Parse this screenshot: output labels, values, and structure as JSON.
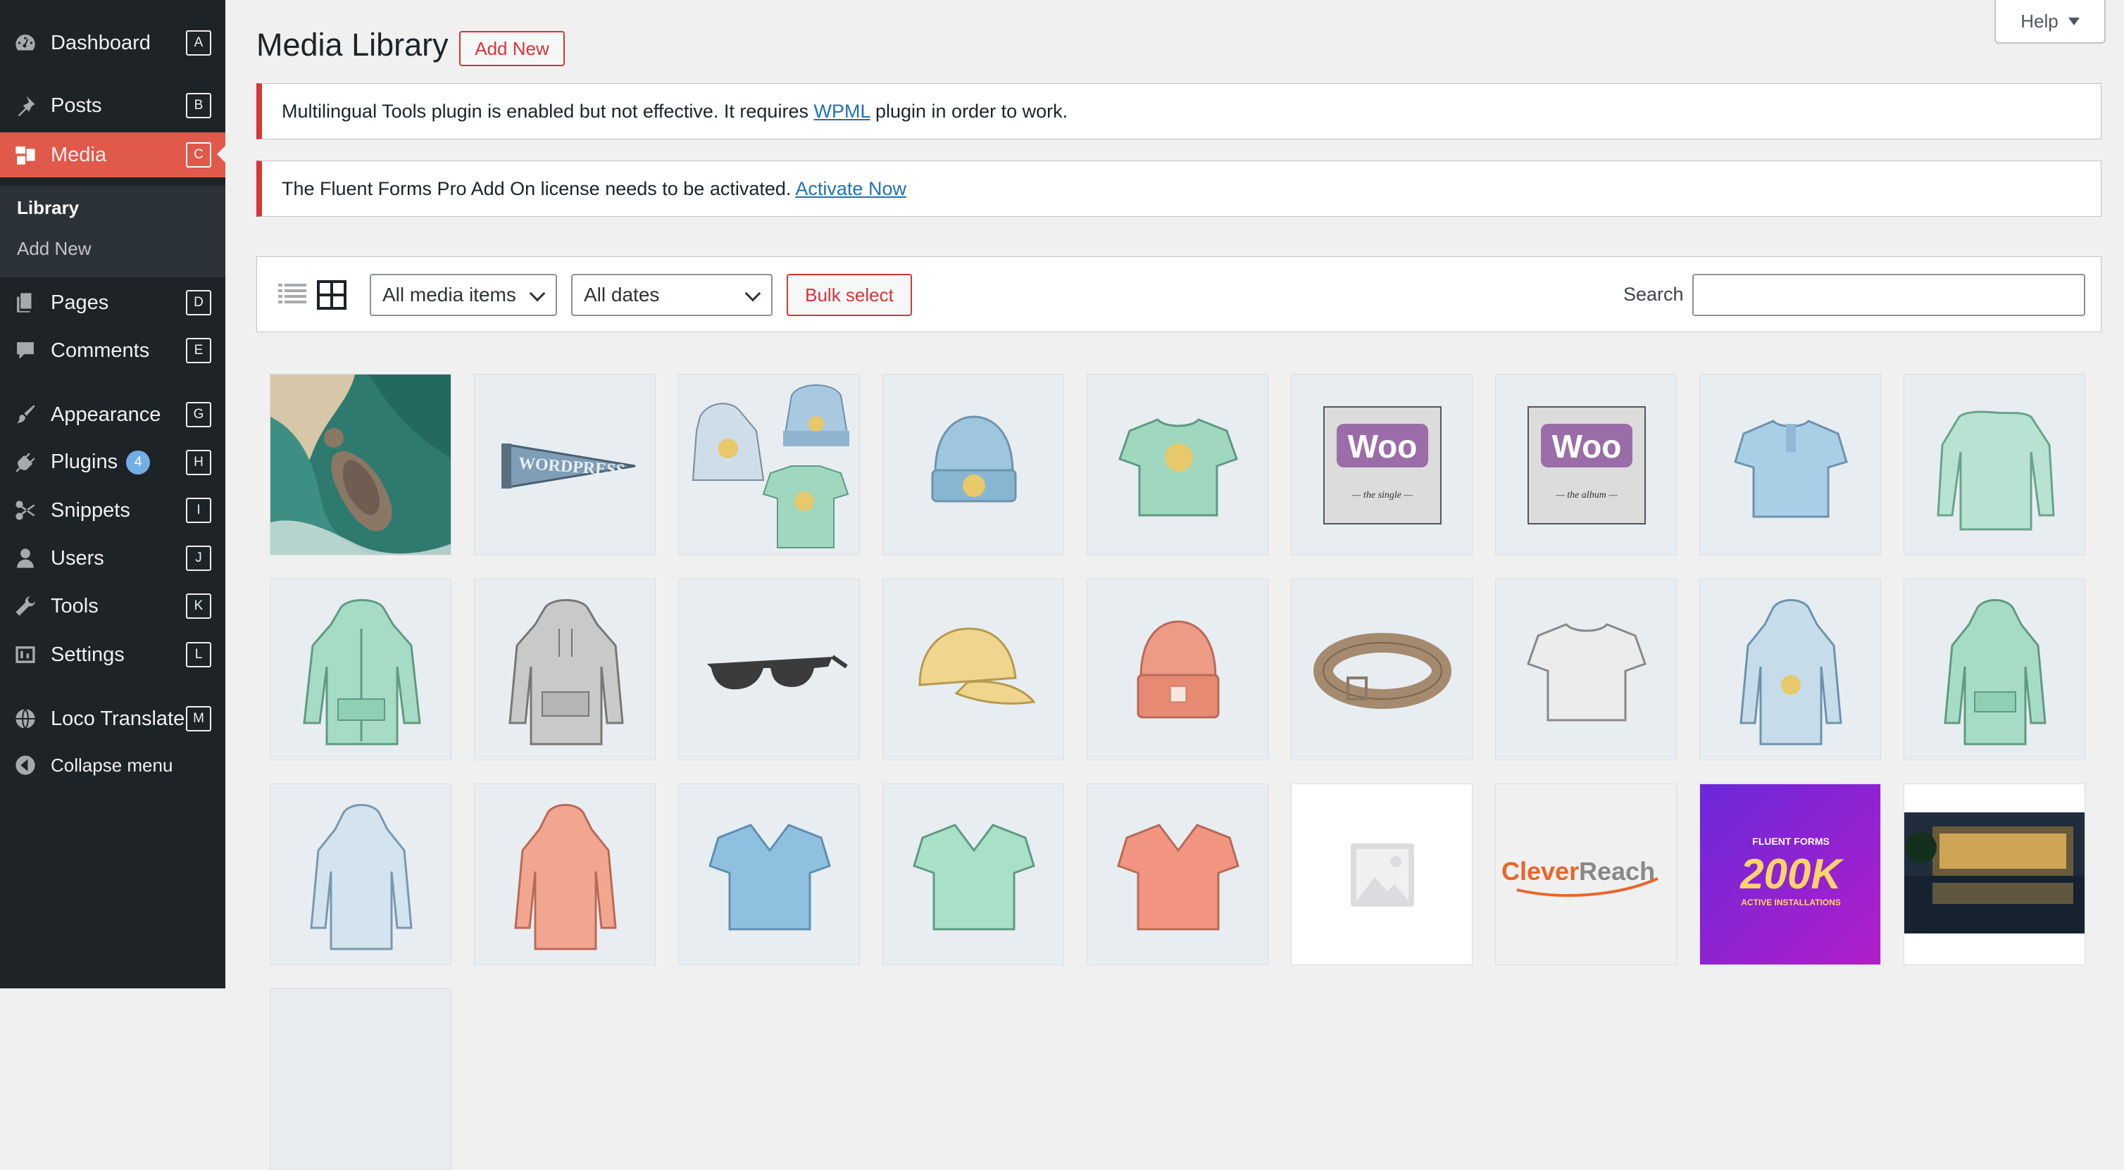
{
  "sidebar": {
    "items": [
      {
        "label": "Dashboard",
        "key": "A",
        "icon": "dashboard-icon"
      },
      {
        "label": "Posts",
        "key": "B",
        "icon": "pushpin-icon"
      },
      {
        "label": "Media",
        "key": "C",
        "icon": "media-icon"
      },
      {
        "label": "Pages",
        "key": "D",
        "icon": "pages-icon"
      },
      {
        "label": "Comments",
        "key": "E",
        "icon": "comment-icon"
      },
      {
        "label": "Appearance",
        "key": "G",
        "icon": "paintbrush-icon"
      },
      {
        "label": "Plugins",
        "key": "H",
        "icon": "plugin-icon",
        "badge": "4"
      },
      {
        "label": "Snippets",
        "key": "I",
        "icon": "scissors-icon"
      },
      {
        "label": "Users",
        "key": "J",
        "icon": "user-icon"
      },
      {
        "label": "Tools",
        "key": "K",
        "icon": "wrench-icon"
      },
      {
        "label": "Settings",
        "key": "L",
        "icon": "settings-sliders-icon"
      },
      {
        "label": "Loco Translate",
        "key": "M",
        "icon": "translate-icon"
      },
      {
        "label": "Collapse menu",
        "icon": "collapse-arrow-icon"
      }
    ],
    "submenu": [
      {
        "label": "Library",
        "current": true
      },
      {
        "label": "Add New",
        "current": false
      }
    ]
  },
  "header": {
    "title": "Media Library",
    "add_new_label": "Add New",
    "help_label": "Help"
  },
  "notices": [
    {
      "text_before": "Multilingual Tools plugin is enabled but not effective. It requires ",
      "link": "WPML",
      "text_after": " plugin in order to work."
    },
    {
      "text_before": "The Fluent Forms Pro Add On license needs to be activated. ",
      "link": "Activate Now",
      "text_after": ""
    }
  ],
  "toolbar": {
    "filter_type": "All media items",
    "filter_date": "All dates",
    "bulk_select_label": "Bulk select",
    "search_label": "Search",
    "search_value": ""
  },
  "media_items": [
    "coastal-aerial-photo",
    "wordpress-pennant",
    "hoodie-beanie-tshirt-set",
    "beanie-blue",
    "tshirt-green-smiley",
    "woo-album-single",
    "woo-album",
    "polo-blue",
    "long-sleeve-green",
    "hoodie-zip-green",
    "hoodie-gray",
    "sunglasses",
    "cap-yellow",
    "beanie-orange",
    "belt-brown",
    "tshirt-white",
    "hoodie-blue-logo",
    "hoodie-green",
    "hoodie-blue",
    "hoodie-orange",
    "vneck-blue",
    "vneck-green",
    "vneck-orange",
    "placeholder-image",
    "cleverreach-logo",
    "fluent-forms-200k",
    "hotel-night-photo"
  ],
  "colors": {
    "sidebar_bg": "#1d2327",
    "active_menu": "#e0594b",
    "link": "#2271b1",
    "danger": "#d63638"
  }
}
